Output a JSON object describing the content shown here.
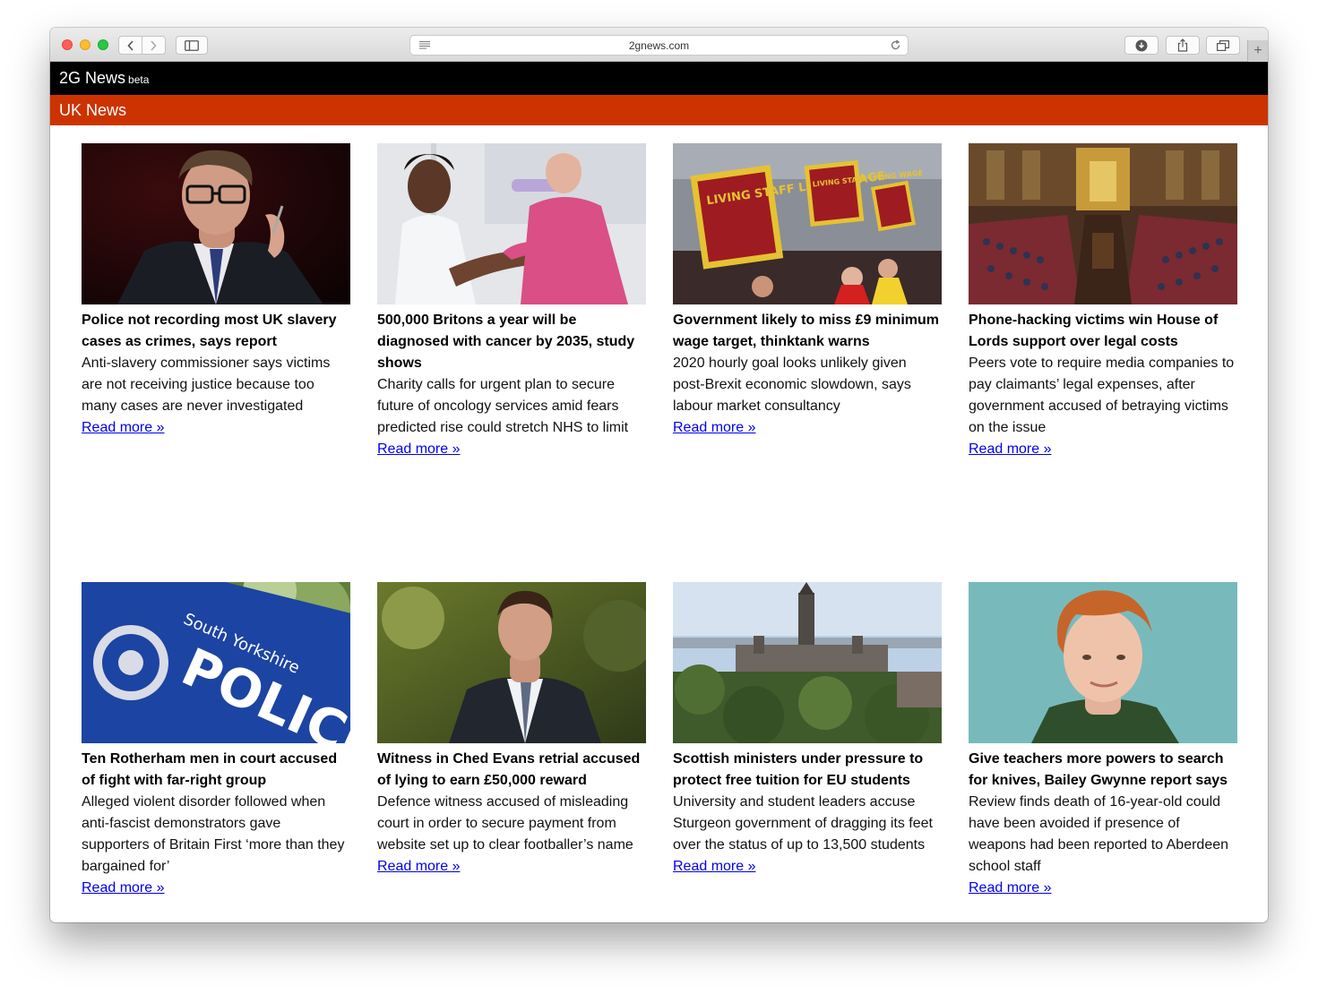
{
  "browser": {
    "url": "2gnews.com"
  },
  "site": {
    "title": "2G News",
    "badge": "beta"
  },
  "section": {
    "title": "UK News"
  },
  "articles": [
    {
      "headline": "Police not recording most UK slavery cases as crimes, says report",
      "summary": "Anti-slavery commissioner says victims are not receiving justice because too many cases are never investigated",
      "link": "Read more »"
    },
    {
      "headline": "500,000 Britons a year will be diagnosed with cancer by 2035, study shows",
      "summary": "Charity calls for urgent plan to secure future of oncology services amid fears predicted rise could stretch NHS to limit",
      "link": "Read more »"
    },
    {
      "headline": "Government likely to miss £9 minimum wage target, thinktank warns",
      "summary": "2020 hourly goal looks unlikely given post-Brexit economic slowdown, says labour market consultancy",
      "link": "Read more »"
    },
    {
      "headline": "Phone-hacking victims win House of Lords support over legal costs",
      "summary": "Peers vote to require media companies to pay claimants’ legal expenses, after government accused of betraying victims on the issue",
      "link": "Read more »"
    },
    {
      "headline": "Ten Rotherham men in court accused of fight with far-right group",
      "summary": "Alleged violent disorder followed when anti-fascist demonstrators gave supporters of Britain First ‘more than they bargained for’",
      "link": "Read more »"
    },
    {
      "headline": "Witness in Ched Evans retrial accused of lying to earn £50,000 reward",
      "summary": "Defence witness accused of misleading court in order to secure payment from website set up to clear footballer’s name",
      "link": "Read more »"
    },
    {
      "headline": "Scottish ministers under pressure to protect free tuition for EU students",
      "summary": "University and student leaders accuse Sturgeon government of dragging its feet over the status of up to 13,500 students",
      "link": "Read more »"
    },
    {
      "headline": "Give teachers more powers to search for knives, Bailey Gwynne report says",
      "summary": "Review finds death of 16-year-old could have been avoided if presence of weapons had been reported to Aberdeen school staff",
      "link": "Read more »"
    }
  ],
  "photo_signs": {
    "wage_sign_1": "LIVING STAFF LIVING WAGE",
    "wage_sign_2": "LIVING STAFF LIVING WAGE",
    "police_sign": "POLICE",
    "police_sub": "South Yorkshire"
  },
  "colors": {
    "header_bg": "#000000",
    "section_bg": "#cc3300",
    "link": "#0000ee"
  }
}
